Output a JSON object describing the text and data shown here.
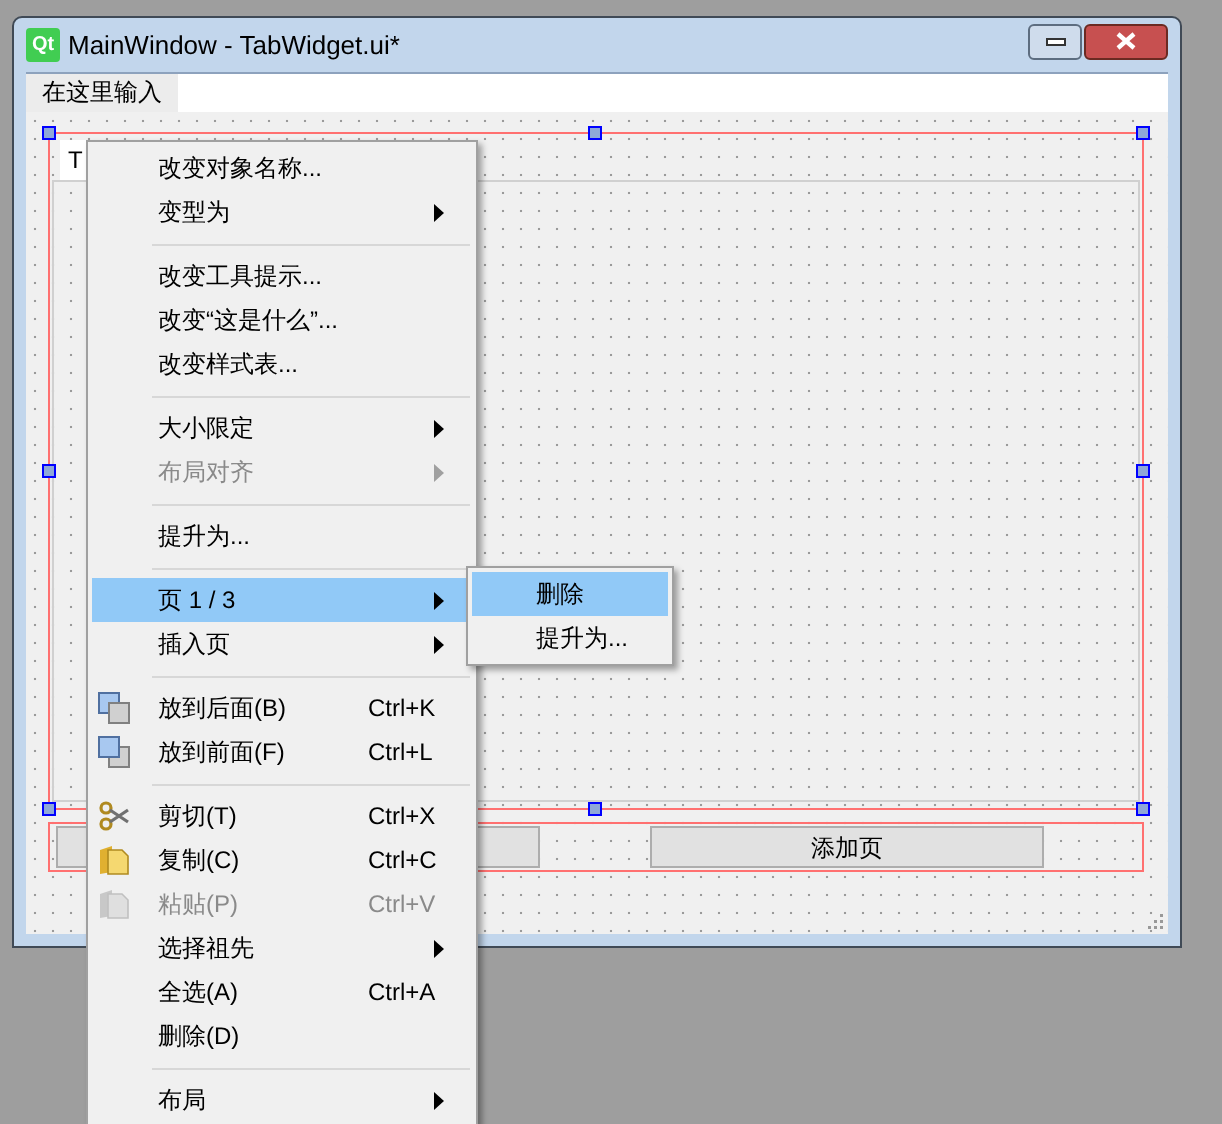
{
  "window": {
    "logo": "Qt",
    "title": "MainWindow - TabWidget.ui*"
  },
  "menubar": {
    "items": [
      {
        "label": "在这里输入"
      }
    ]
  },
  "tab_widget": {
    "tabs": [
      {
        "label": "T",
        "selected": true
      }
    ]
  },
  "buttons": [
    {
      "kind": "covered"
    },
    {
      "kind": "labeled",
      "label": "添加页"
    }
  ],
  "context_menu": [
    {
      "kind": "item",
      "label": "改变对象名称...",
      "submenu": false,
      "disabled": false,
      "selected": false
    },
    {
      "kind": "item",
      "label": "变型为",
      "submenu": true,
      "disabled": false,
      "selected": false
    },
    {
      "kind": "separator"
    },
    {
      "kind": "item",
      "label": "改变工具提示...",
      "submenu": false,
      "disabled": false,
      "selected": false
    },
    {
      "kind": "item",
      "label": "改变“这是什么”...",
      "submenu": false,
      "disabled": false,
      "selected": false
    },
    {
      "kind": "item",
      "label": "改变样式表...",
      "submenu": false,
      "disabled": false,
      "selected": false
    },
    {
      "kind": "separator"
    },
    {
      "kind": "item",
      "label": "大小限定",
      "submenu": true,
      "disabled": false,
      "selected": false
    },
    {
      "kind": "item",
      "label": "布局对齐",
      "submenu": true,
      "disabled": true,
      "selected": false
    },
    {
      "kind": "separator"
    },
    {
      "kind": "item",
      "label": "提升为...",
      "submenu": false,
      "disabled": false,
      "selected": false
    },
    {
      "kind": "separator"
    },
    {
      "kind": "item",
      "label": "页 1 / 3",
      "submenu": true,
      "disabled": false,
      "selected": true
    },
    {
      "kind": "item",
      "label": "插入页",
      "submenu": true,
      "disabled": false,
      "selected": false
    },
    {
      "kind": "separator"
    },
    {
      "kind": "item",
      "label": "放到后面(B)",
      "shortcut": "Ctrl+K",
      "submenu": false,
      "disabled": false,
      "selected": false
    },
    {
      "kind": "item",
      "label": "放到前面(F)",
      "shortcut": "Ctrl+L",
      "submenu": false,
      "disabled": false,
      "selected": false
    },
    {
      "kind": "separator"
    },
    {
      "kind": "item",
      "label": "剪切(T)",
      "shortcut": "Ctrl+X",
      "submenu": false,
      "disabled": false,
      "selected": false
    },
    {
      "kind": "item",
      "label": "复制(C)",
      "shortcut": "Ctrl+C",
      "submenu": false,
      "disabled": false,
      "selected": false
    },
    {
      "kind": "item",
      "label": "粘贴(P)",
      "shortcut": "Ctrl+V",
      "submenu": false,
      "disabled": true,
      "selected": false
    },
    {
      "kind": "item",
      "label": "选择祖先",
      "submenu": true,
      "disabled": false,
      "selected": false
    },
    {
      "kind": "item",
      "label": "全选(A)",
      "shortcut": "Ctrl+A",
      "submenu": false,
      "disabled": false,
      "selected": false
    },
    {
      "kind": "item",
      "label": "删除(D)",
      "submenu": false,
      "disabled": false,
      "selected": false
    },
    {
      "kind": "separator"
    },
    {
      "kind": "item",
      "label": "布局",
      "submenu": true,
      "disabled": false,
      "selected": false
    }
  ],
  "submenu": [
    {
      "label": "删除",
      "selected": true
    },
    {
      "label": "提升为...",
      "selected": false
    }
  ]
}
